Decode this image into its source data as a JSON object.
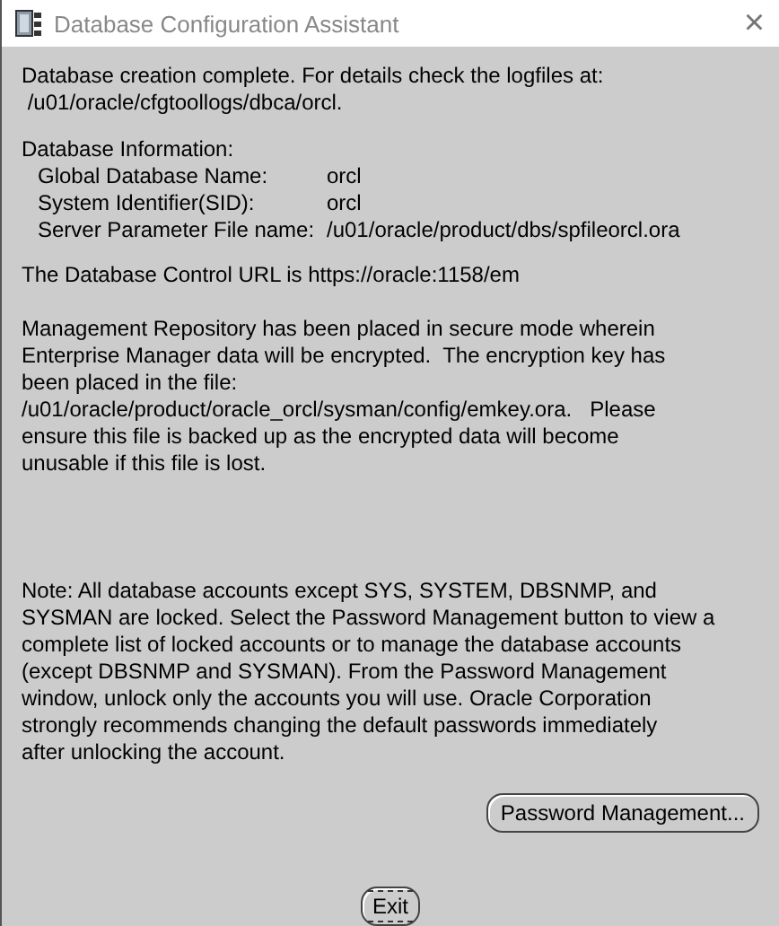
{
  "window": {
    "title": "Database Configuration Assistant",
    "close": "×"
  },
  "intro": [
    "Database creation complete. For details check the logfiles at:",
    " /u01/oracle/cfgtoollogs/dbca/orcl."
  ],
  "info": {
    "heading": "Database Information:",
    "rows": [
      {
        "label": "Global Database Name:",
        "value": "orcl"
      },
      {
        "label": "System Identifier(SID):",
        "value": "orcl"
      },
      {
        "label": "Server Parameter File name:",
        "value": "/u01/oracle/product/dbs/spfileorcl.ora"
      }
    ]
  },
  "url_text": "The Database Control URL is https://oracle:1158/em",
  "repository_note": [
    "Management Repository has been placed in secure mode wherein",
    "Enterprise Manager data will be encrypted.  The encryption key has",
    "been placed in the file:",
    "/u01/oracle/product/oracle_orcl/sysman/config/emkey.ora.   Please",
    "ensure this file is backed up as the encrypted data will become",
    "unusable if this file is lost."
  ],
  "accounts_note": [
    "Note: All database accounts except SYS, SYSTEM, DBSNMP, and",
    "SYSMAN are locked. Select the Password Management button to view a",
    "complete list of locked accounts or to manage the database accounts",
    "(except DBSNMP and SYSMAN). From the Password Management",
    "window, unlock only the accounts you will use. Oracle Corporation",
    "strongly recommends changing the default passwords immediately",
    "after unlocking the account."
  ],
  "buttons": [
    {
      "label": "Password Management...",
      "focused": false
    },
    {
      "label": "Exit",
      "focused": true
    }
  ]
}
